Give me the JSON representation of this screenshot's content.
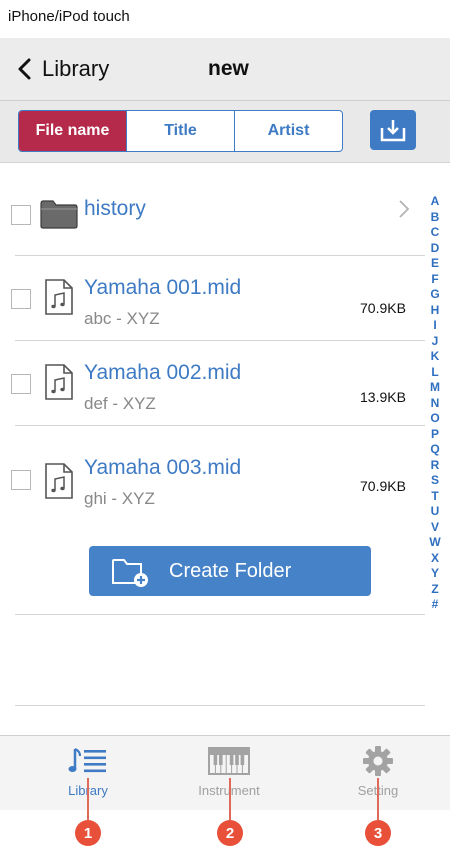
{
  "device_label": "iPhone/iPod touch",
  "navbar": {
    "back_label": "Library",
    "title": "new"
  },
  "segments": [
    {
      "label": "File name",
      "active": true
    },
    {
      "label": "Title",
      "active": false
    },
    {
      "label": "Artist",
      "active": false
    }
  ],
  "download_button": {
    "icon": "download-icon"
  },
  "folder": {
    "name": "history",
    "icon": "folder-icon"
  },
  "files": [
    {
      "name": "Yamaha 001.mid",
      "subtitle": "abc - XYZ",
      "size": "70.9KB",
      "icon": "music-file-icon"
    },
    {
      "name": "Yamaha 002.mid",
      "subtitle": "def - XYZ",
      "size": "13.9KB",
      "icon": "music-file-icon"
    },
    {
      "name": "Yamaha 003.mid",
      "subtitle": "ghi - XYZ",
      "size": "70.9KB",
      "icon": "music-file-icon"
    }
  ],
  "create_folder": {
    "label": "Create Folder",
    "icon": "new-folder-icon"
  },
  "index_letters": [
    "A",
    "B",
    "C",
    "D",
    "E",
    "F",
    "G",
    "H",
    "I",
    "J",
    "K",
    "L",
    "M",
    "N",
    "O",
    "P",
    "Q",
    "R",
    "S",
    "T",
    "U",
    "V",
    "W",
    "X",
    "Y",
    "Z",
    "#"
  ],
  "tabs": [
    {
      "label": "Library",
      "icon": "library-icon",
      "active": true
    },
    {
      "label": "Instrument",
      "icon": "piano-keyboard-icon",
      "active": false
    },
    {
      "label": "Setting",
      "icon": "gear-icon",
      "active": false
    }
  ],
  "callouts": [
    "1",
    "2",
    "3"
  ],
  "colors": {
    "accent": "#3e7bc4",
    "active_segment": "#b52a4a",
    "callout": "#e8503a"
  }
}
